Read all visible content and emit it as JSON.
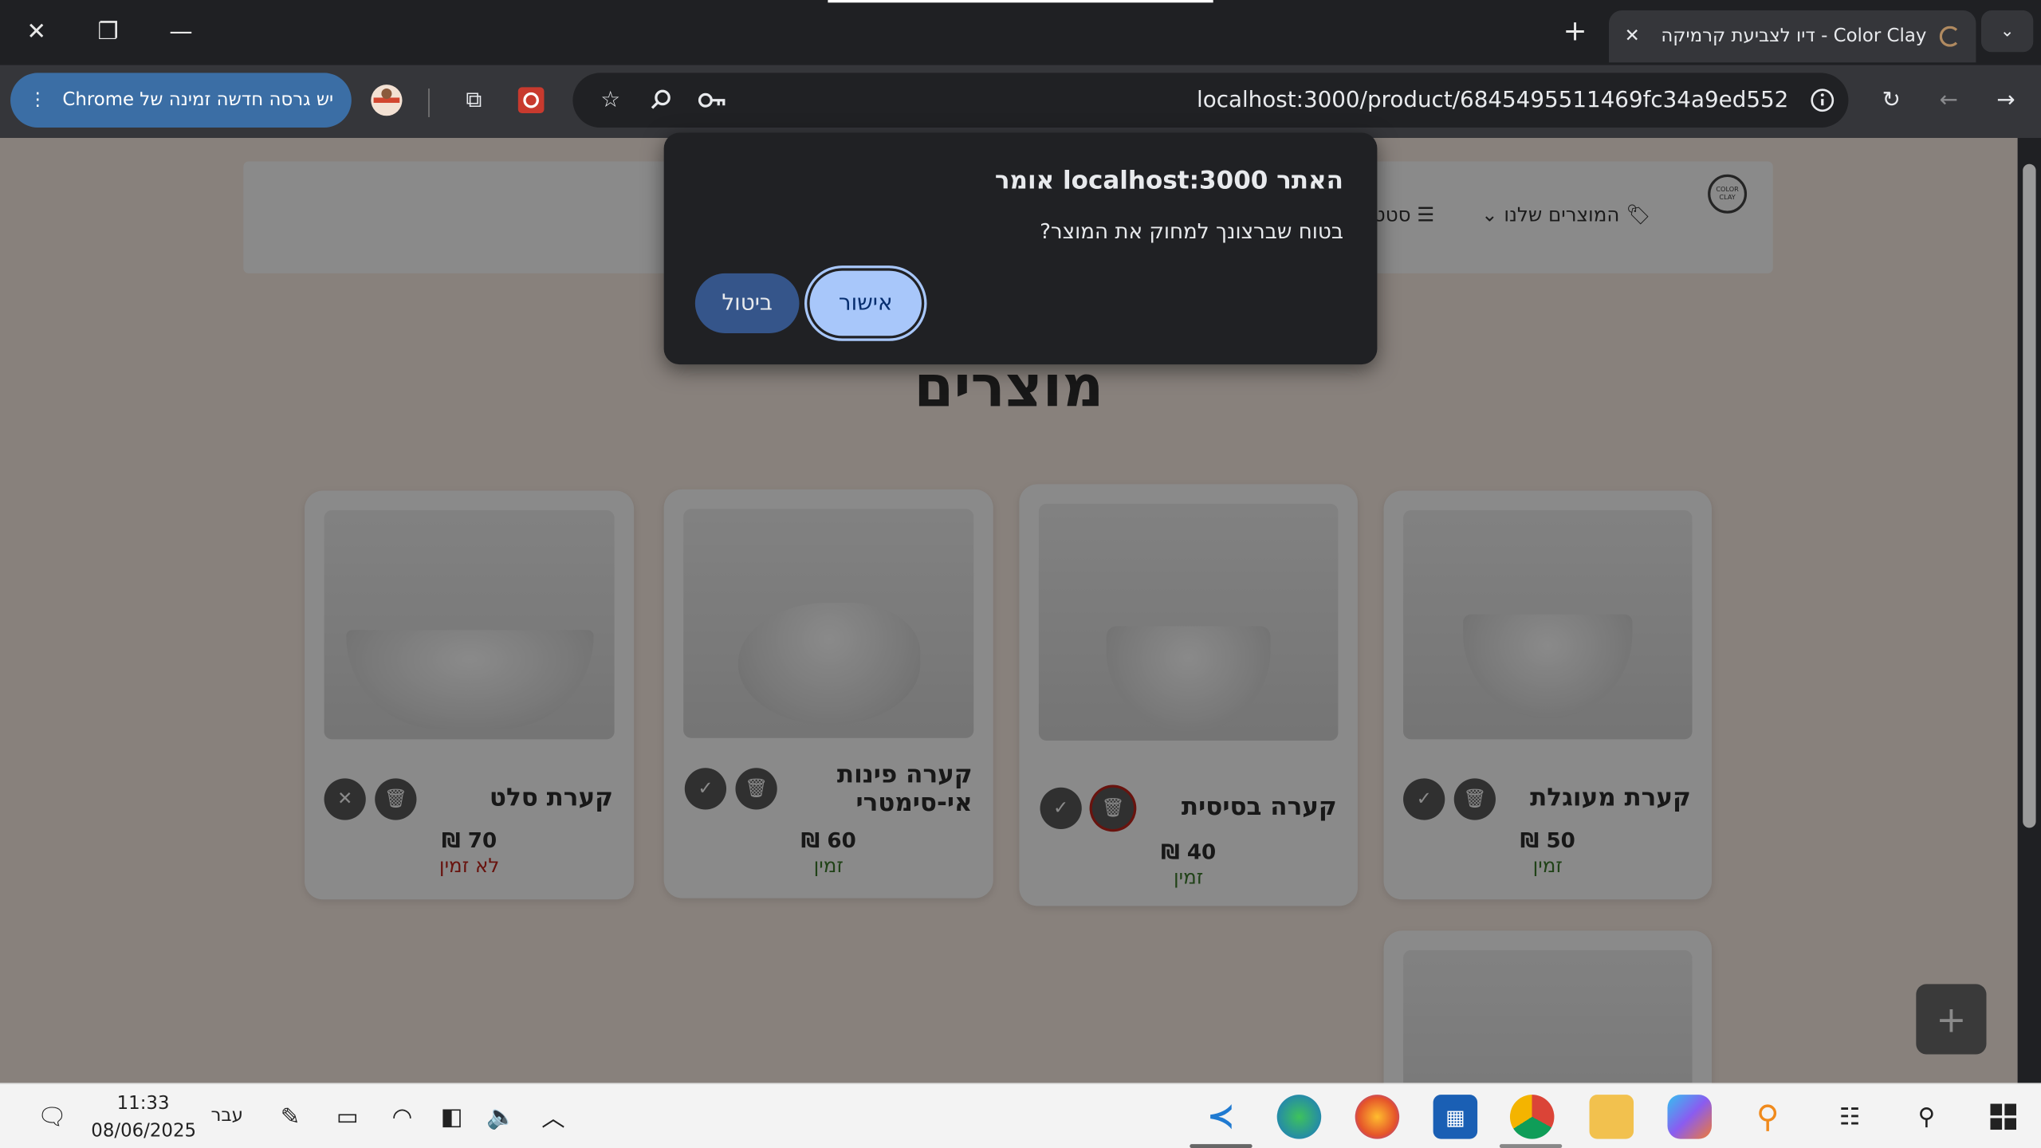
{
  "browser": {
    "tab_title": "Color Clay - דיו לצביעת קרמיקה",
    "url": "localhost:3000/product/6845495511469fc34a9ed552",
    "update_label": "יש גרסה חדשה זמינה של Chrome"
  },
  "site": {
    "logo_text": "COLOR CLAY",
    "nav": {
      "products": "המוצרים שלנו",
      "stats": "סטט"
    },
    "page_title": "מוצרים",
    "products": [
      {
        "name": "קערת מעוגלת",
        "price": "50 ₪",
        "status": "זמין",
        "status_color": "#3c7a2b"
      },
      {
        "name": "קערה בסיסית",
        "price": "40 ₪",
        "status": "זמין",
        "status_color": "#3c7a2b"
      },
      {
        "name": "קערה פינות אי-סימטרי",
        "price": "60 ₪",
        "status": "זמין",
        "status_color": "#3c7a2b"
      },
      {
        "name": "קערת סלט",
        "price": "70 ₪",
        "status": "לא זמין",
        "status_color": "#c0241b"
      }
    ],
    "fab_label": "+"
  },
  "dialog": {
    "title": "האתר localhost:3000 אומר",
    "message": "בטוח שברצונך למחוק את המוצר?",
    "ok_label": "אישור",
    "cancel_label": "ביטול"
  },
  "taskbar": {
    "time": "11:33",
    "date": "08/06/2025",
    "language": "עבר"
  },
  "colors": {
    "dialog_bg": "#202124",
    "ok_button": "#a8c7fa",
    "cancel_button": "#35558a",
    "page_bg": "#fbeee5",
    "available": "#3c7a2b",
    "unavailable": "#c0241b"
  }
}
